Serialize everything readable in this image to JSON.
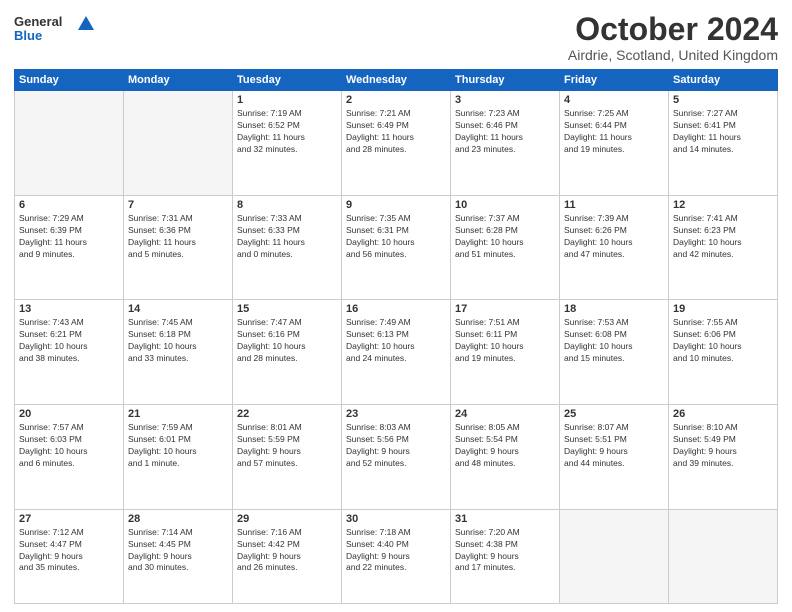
{
  "logo": {
    "line1": "General",
    "line2": "Blue"
  },
  "title": "October 2024",
  "location": "Airdrie, Scotland, United Kingdom",
  "weekdays": [
    "Sunday",
    "Monday",
    "Tuesday",
    "Wednesday",
    "Thursday",
    "Friday",
    "Saturday"
  ],
  "weeks": [
    [
      {
        "day": "",
        "info": ""
      },
      {
        "day": "",
        "info": ""
      },
      {
        "day": "1",
        "info": "Sunrise: 7:19 AM\nSunset: 6:52 PM\nDaylight: 11 hours\nand 32 minutes."
      },
      {
        "day": "2",
        "info": "Sunrise: 7:21 AM\nSunset: 6:49 PM\nDaylight: 11 hours\nand 28 minutes."
      },
      {
        "day": "3",
        "info": "Sunrise: 7:23 AM\nSunset: 6:46 PM\nDaylight: 11 hours\nand 23 minutes."
      },
      {
        "day": "4",
        "info": "Sunrise: 7:25 AM\nSunset: 6:44 PM\nDaylight: 11 hours\nand 19 minutes."
      },
      {
        "day": "5",
        "info": "Sunrise: 7:27 AM\nSunset: 6:41 PM\nDaylight: 11 hours\nand 14 minutes."
      }
    ],
    [
      {
        "day": "6",
        "info": "Sunrise: 7:29 AM\nSunset: 6:39 PM\nDaylight: 11 hours\nand 9 minutes."
      },
      {
        "day": "7",
        "info": "Sunrise: 7:31 AM\nSunset: 6:36 PM\nDaylight: 11 hours\nand 5 minutes."
      },
      {
        "day": "8",
        "info": "Sunrise: 7:33 AM\nSunset: 6:33 PM\nDaylight: 11 hours\nand 0 minutes."
      },
      {
        "day": "9",
        "info": "Sunrise: 7:35 AM\nSunset: 6:31 PM\nDaylight: 10 hours\nand 56 minutes."
      },
      {
        "day": "10",
        "info": "Sunrise: 7:37 AM\nSunset: 6:28 PM\nDaylight: 10 hours\nand 51 minutes."
      },
      {
        "day": "11",
        "info": "Sunrise: 7:39 AM\nSunset: 6:26 PM\nDaylight: 10 hours\nand 47 minutes."
      },
      {
        "day": "12",
        "info": "Sunrise: 7:41 AM\nSunset: 6:23 PM\nDaylight: 10 hours\nand 42 minutes."
      }
    ],
    [
      {
        "day": "13",
        "info": "Sunrise: 7:43 AM\nSunset: 6:21 PM\nDaylight: 10 hours\nand 38 minutes."
      },
      {
        "day": "14",
        "info": "Sunrise: 7:45 AM\nSunset: 6:18 PM\nDaylight: 10 hours\nand 33 minutes."
      },
      {
        "day": "15",
        "info": "Sunrise: 7:47 AM\nSunset: 6:16 PM\nDaylight: 10 hours\nand 28 minutes."
      },
      {
        "day": "16",
        "info": "Sunrise: 7:49 AM\nSunset: 6:13 PM\nDaylight: 10 hours\nand 24 minutes."
      },
      {
        "day": "17",
        "info": "Sunrise: 7:51 AM\nSunset: 6:11 PM\nDaylight: 10 hours\nand 19 minutes."
      },
      {
        "day": "18",
        "info": "Sunrise: 7:53 AM\nSunset: 6:08 PM\nDaylight: 10 hours\nand 15 minutes."
      },
      {
        "day": "19",
        "info": "Sunrise: 7:55 AM\nSunset: 6:06 PM\nDaylight: 10 hours\nand 10 minutes."
      }
    ],
    [
      {
        "day": "20",
        "info": "Sunrise: 7:57 AM\nSunset: 6:03 PM\nDaylight: 10 hours\nand 6 minutes."
      },
      {
        "day": "21",
        "info": "Sunrise: 7:59 AM\nSunset: 6:01 PM\nDaylight: 10 hours\nand 1 minute."
      },
      {
        "day": "22",
        "info": "Sunrise: 8:01 AM\nSunset: 5:59 PM\nDaylight: 9 hours\nand 57 minutes."
      },
      {
        "day": "23",
        "info": "Sunrise: 8:03 AM\nSunset: 5:56 PM\nDaylight: 9 hours\nand 52 minutes."
      },
      {
        "day": "24",
        "info": "Sunrise: 8:05 AM\nSunset: 5:54 PM\nDaylight: 9 hours\nand 48 minutes."
      },
      {
        "day": "25",
        "info": "Sunrise: 8:07 AM\nSunset: 5:51 PM\nDaylight: 9 hours\nand 44 minutes."
      },
      {
        "day": "26",
        "info": "Sunrise: 8:10 AM\nSunset: 5:49 PM\nDaylight: 9 hours\nand 39 minutes."
      }
    ],
    [
      {
        "day": "27",
        "info": "Sunrise: 7:12 AM\nSunset: 4:47 PM\nDaylight: 9 hours\nand 35 minutes."
      },
      {
        "day": "28",
        "info": "Sunrise: 7:14 AM\nSunset: 4:45 PM\nDaylight: 9 hours\nand 30 minutes."
      },
      {
        "day": "29",
        "info": "Sunrise: 7:16 AM\nSunset: 4:42 PM\nDaylight: 9 hours\nand 26 minutes."
      },
      {
        "day": "30",
        "info": "Sunrise: 7:18 AM\nSunset: 4:40 PM\nDaylight: 9 hours\nand 22 minutes."
      },
      {
        "day": "31",
        "info": "Sunrise: 7:20 AM\nSunset: 4:38 PM\nDaylight: 9 hours\nand 17 minutes."
      },
      {
        "day": "",
        "info": ""
      },
      {
        "day": "",
        "info": ""
      }
    ]
  ]
}
